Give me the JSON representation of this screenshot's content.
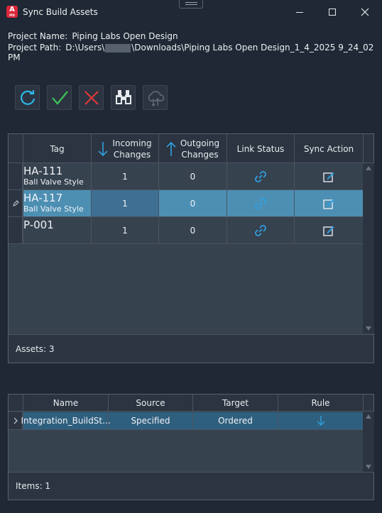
{
  "window": {
    "title": "Sync Build Assets"
  },
  "project": {
    "name_label": "Project Name:",
    "name_value": "Piping Labs Open Design",
    "path_label": "Project Path:",
    "path_prefix": "D:\\Users\\",
    "path_suffix": "\\Downloads\\Piping Labs Open Design_1_4_2025 9_24_02 PM"
  },
  "toolbar": {
    "buttons": [
      {
        "name": "refresh",
        "icon": "refresh-icon"
      },
      {
        "name": "accept",
        "icon": "check-icon"
      },
      {
        "name": "reject",
        "icon": "x-icon"
      },
      {
        "name": "find",
        "icon": "binoculars-icon"
      },
      {
        "name": "cloud-sync",
        "icon": "cloud-sync-icon"
      }
    ]
  },
  "assets_grid": {
    "headers": {
      "tag": "Tag",
      "incoming_1": "Incoming",
      "incoming_2": "Changes",
      "outgoing_1": "Outgoing",
      "outgoing_2": "Changes",
      "link_status": "Link Status",
      "sync_action": "Sync Action"
    },
    "rows": [
      {
        "tag": "HA-111",
        "desc": "Ball Valve Style",
        "incoming": "1",
        "outgoing": "0"
      },
      {
        "tag": "HA-117",
        "desc": "Ball Valve Style",
        "incoming": "1",
        "outgoing": "0"
      },
      {
        "tag": "P-001",
        "desc": "",
        "incoming": "1",
        "outgoing": "0"
      }
    ],
    "footer": "Assets: 3"
  },
  "rules_grid": {
    "headers": {
      "name": "Name",
      "source": "Source",
      "target": "Target",
      "rule": "Rule"
    },
    "rows": [
      {
        "name": "Integration_BuildSt...",
        "source": "Specified",
        "target": "Ordered"
      }
    ],
    "footer": "Items: 1"
  },
  "colors": {
    "accent": "#2f9fe0",
    "selected_row": "#4d8fb3",
    "close": "#d9263a"
  }
}
